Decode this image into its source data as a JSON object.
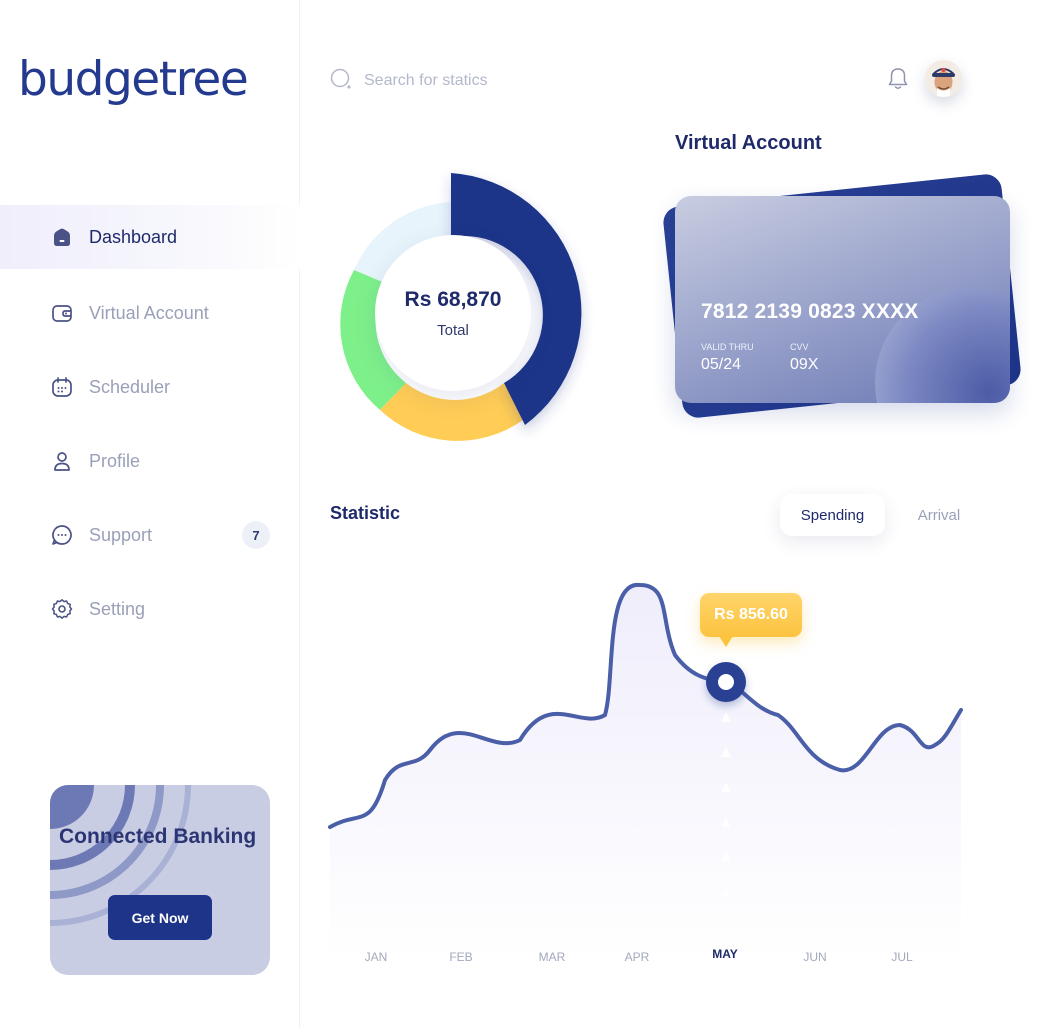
{
  "app": {
    "logo": "budgetree"
  },
  "sidebar": {
    "items": [
      {
        "label": "Dashboard",
        "icon": "home-icon",
        "active": true
      },
      {
        "label": "Virtual Account",
        "icon": "wallet-icon"
      },
      {
        "label": "Scheduler",
        "icon": "calendar-icon"
      },
      {
        "label": "Profile",
        "icon": "user-icon"
      },
      {
        "label": "Support",
        "icon": "chat-icon",
        "badge": "7"
      },
      {
        "label": "Setting",
        "icon": "gear-icon"
      }
    ],
    "promo": {
      "title": "Connected Banking",
      "button": "Get Now"
    }
  },
  "header": {
    "search_placeholder": "Search for statics",
    "icons": [
      "search-icon",
      "bell-icon"
    ]
  },
  "donut": {
    "amount": "Rs 68,870",
    "label": "Total",
    "segments": [
      {
        "color": "#1e3488",
        "share": 0.42
      },
      {
        "color": "#ffcc55",
        "share": 0.19
      },
      {
        "color": "#7ef08a",
        "share": 0.18
      },
      {
        "color": "#e8f4fb",
        "share": 0.21
      }
    ]
  },
  "virtual_account": {
    "title": "Virtual Account",
    "card_number": "7812 2139 0823 XXXX",
    "valid_label": "VALID THRU",
    "valid": "05/24",
    "cvv_label": "CVV",
    "cvv": "09X"
  },
  "statistic": {
    "title": "Statistic",
    "tabs": [
      {
        "label": "Spending",
        "active": true
      },
      {
        "label": "Arrival",
        "active": false
      }
    ],
    "tooltip": "Rs 856.60",
    "selected_month": "MAY"
  },
  "chart_data": {
    "type": "area",
    "categories": [
      "JAN",
      "FEB",
      "MAR",
      "APR",
      "MAY",
      "JUN",
      "JUL"
    ],
    "highlighted_category": "MAY",
    "highlighted_value_label": "Rs 856.60",
    "line_color": "#4a5fa8",
    "fill_color": "#f1effc"
  }
}
